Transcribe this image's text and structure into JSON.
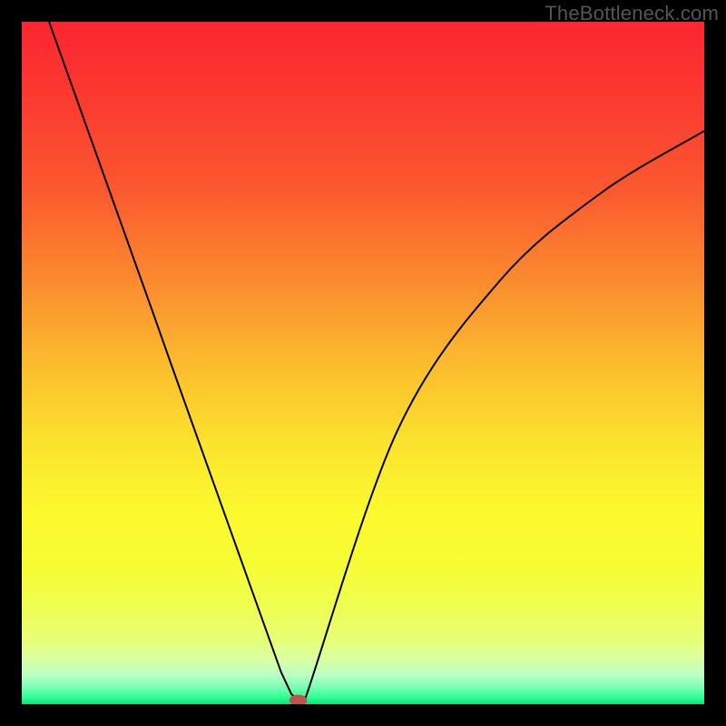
{
  "watermark": "TheBottleneck.com",
  "chart_data": {
    "type": "line",
    "title": "",
    "xlabel": "",
    "ylabel": "",
    "xlim": [
      0,
      100
    ],
    "ylim": [
      0,
      100
    ],
    "grid": false,
    "legend": false,
    "background_gradient": {
      "stops": [
        {
          "offset": 0.0,
          "color": "#fb2630"
        },
        {
          "offset": 0.12,
          "color": "#fb3b30"
        },
        {
          "offset": 0.25,
          "color": "#fb5a2f"
        },
        {
          "offset": 0.38,
          "color": "#fb8b2f"
        },
        {
          "offset": 0.5,
          "color": "#fbbb2e"
        },
        {
          "offset": 0.62,
          "color": "#fbe32e"
        },
        {
          "offset": 0.72,
          "color": "#fbfa2e"
        },
        {
          "offset": 0.8,
          "color": "#f6fc34"
        },
        {
          "offset": 0.86,
          "color": "#eefe52"
        },
        {
          "offset": 0.905,
          "color": "#e8ff75"
        },
        {
          "offset": 0.935,
          "color": "#d9ffa5"
        },
        {
          "offset": 0.958,
          "color": "#b8ffc4"
        },
        {
          "offset": 0.975,
          "color": "#7bffb6"
        },
        {
          "offset": 0.99,
          "color": "#30ff93"
        },
        {
          "offset": 1.0,
          "color": "#06e276"
        }
      ]
    },
    "series": [
      {
        "name": "bottleneck-curve",
        "color": "#000000",
        "stroke_width": 2,
        "x": [
          4,
          7,
          10,
          13,
          16,
          19,
          22,
          25,
          28,
          31,
          34,
          36,
          38,
          39.5,
          40.8,
          41.6,
          55,
          70,
          85,
          100
        ],
        "y": [
          100,
          91.6,
          83.2,
          74.8,
          66.4,
          58.0,
          49.5,
          41.1,
          32.7,
          24.3,
          15.9,
          10.3,
          4.7,
          1.5,
          0.3,
          1.0,
          40.0,
          62.0,
          75.0,
          84.0
        ]
      }
    ],
    "marker": {
      "name": "optimal-point",
      "x": 40.5,
      "y": 0.6,
      "rx": 1.3,
      "ry": 0.8,
      "color": "#c0524f"
    }
  }
}
